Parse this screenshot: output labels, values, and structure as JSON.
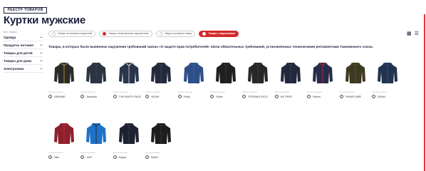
{
  "header": {
    "badge": "РЕЕСТР ТОВАРОВ",
    "title": "Куртки мужские"
  },
  "sidebar": {
    "all_label": "Все товары",
    "items": [
      {
        "label": "Одежда"
      },
      {
        "label": "Продукты питания"
      },
      {
        "label": "Товары для детей"
      },
      {
        "label": "Товары для дома"
      },
      {
        "label": "Электроника"
      }
    ]
  },
  "filters": [
    {
      "label": "Товары не выявлено нарушений"
    },
    {
      "label": "Товары с выявленными нарушениями"
    },
    {
      "label": "Ведутся проверки товара"
    },
    {
      "label": "Товары с нарушениями"
    }
  ],
  "notice": "Товары, в которых были выявлены нарушения требований закона «О защите прав потребителей» и/или обязательных требований, установленных техническими регламентами Таможенного союза.",
  "products": [
    {
      "brand": "NIRVANE",
      "caption": "Куртка мужская",
      "color": "#2b2a28",
      "accent": "#c9a23a"
    },
    {
      "brand": "Ashenick",
      "caption": "Куртка мужская",
      "color": "#2c3440",
      "accent": "#3b4655"
    },
    {
      "brand": "THE NORTH FACE",
      "caption": "Куртка мужская",
      "color": "#29354a",
      "accent": "#e8e8e8"
    },
    {
      "brand": "WOAH",
      "caption": "Куртка мужская",
      "color": "#232a3c",
      "accent": "#3a4560"
    },
    {
      "brand": "Purity",
      "caption": "Куртка мужская",
      "color": "#2e4f86",
      "accent": "#3d63a2"
    },
    {
      "brand": "Globe",
      "caption": "Куртка мужская",
      "color": "#1f1f22",
      "accent": "#3a3a3f"
    },
    {
      "brand": "STEFANO RICCI",
      "caption": "Куртка мужская",
      "color": "#262729",
      "accent": "#3c3d40"
    },
    {
      "brand": "MC PROF",
      "caption": "Куртка мужская",
      "color": "#23283a",
      "accent": "#3a4058"
    },
    {
      "brand": "Eleven",
      "caption": "Куртка мужская",
      "color": "#262d4a",
      "accent": "#c8283a"
    },
    {
      "brand": "THINKFLARE",
      "caption": "Куртка мужская",
      "color": "#3d3a22",
      "accent": "#5a5634"
    },
    {
      "brand": "DEMIX",
      "caption": "Куртка мужская",
      "color": "#22334f",
      "accent": "#3a4e72"
    },
    {
      "brand": "Nike",
      "caption": "Куртка мужская",
      "color": "#8e1f2c",
      "accent": "#b83245"
    },
    {
      "brand": "GAP",
      "caption": "Куртка мужская",
      "color": "#1f72c8",
      "accent": "#222"
    },
    {
      "brand": "Kappa",
      "caption": "Куртка мужская",
      "color": "#1e2230",
      "accent": "#343a4d"
    },
    {
      "brand": "BASH",
      "caption": "Куртка мужская",
      "color": "#1d1d1f",
      "accent": "#343437"
    }
  ],
  "colors": {
    "accent_red": "#d22a2a",
    "text_dark": "#1a1f3c"
  }
}
